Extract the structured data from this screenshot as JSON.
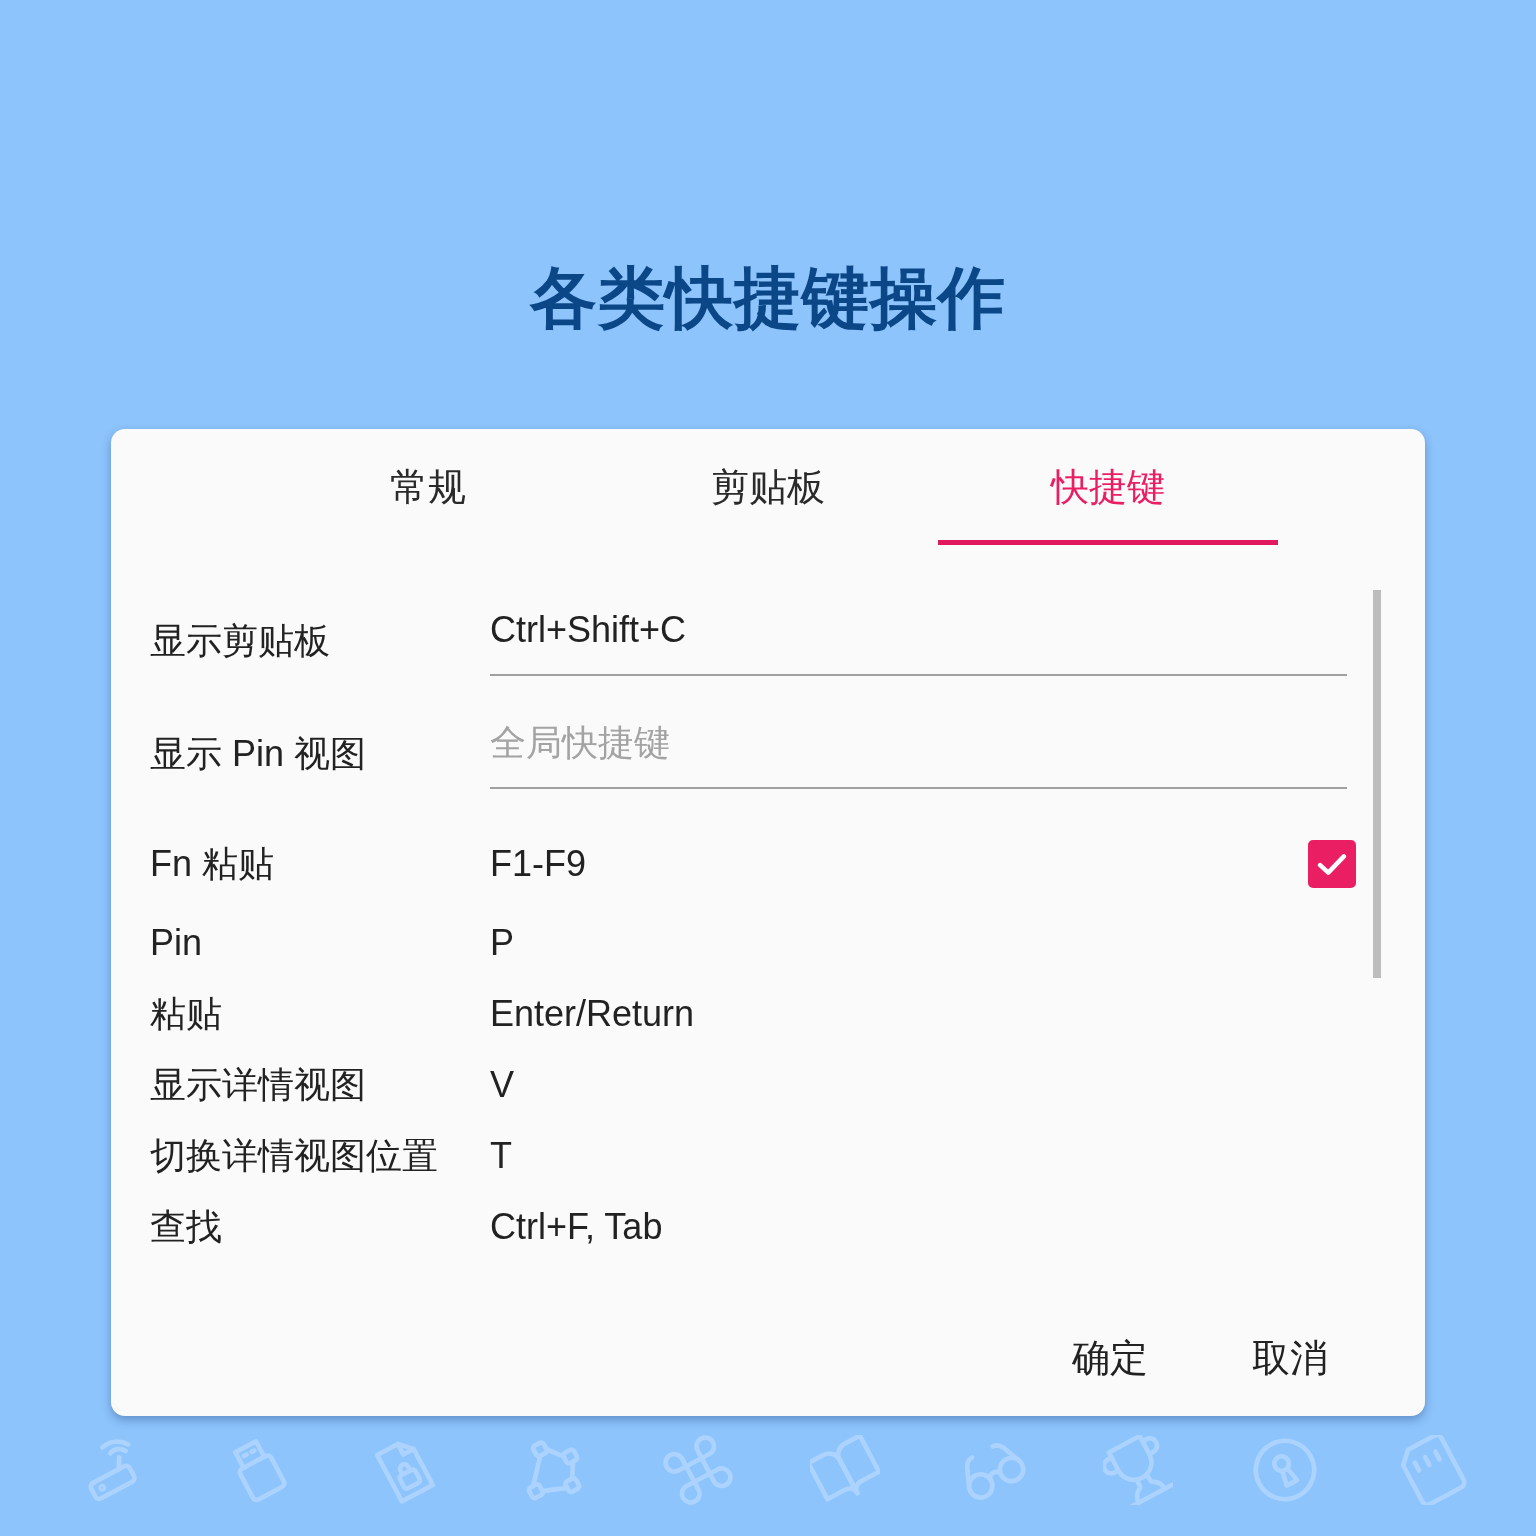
{
  "title": "各类快捷键操作",
  "dialog": {
    "tabs": [
      {
        "label": "常规",
        "selected": false
      },
      {
        "label": "剪贴板",
        "selected": false
      },
      {
        "label": "快捷键",
        "selected": true
      }
    ],
    "settings": [
      {
        "kind": "input",
        "label": "显示剪贴板",
        "value": "Ctrl+Shift+C"
      },
      {
        "kind": "input",
        "label": "显示 Pin 视图",
        "placeholder": "全局快捷键"
      },
      {
        "kind": "checkbox",
        "label": "Fn 粘贴",
        "value": "F1-F9",
        "checked": true
      },
      {
        "kind": "text",
        "label": "Pin",
        "value": "P"
      },
      {
        "kind": "text",
        "label": "粘贴",
        "value": "Enter/Return"
      },
      {
        "kind": "text",
        "label": "显示详情视图",
        "value": "V"
      },
      {
        "kind": "text",
        "label": "切换详情视图位置",
        "value": "T"
      },
      {
        "kind": "text",
        "label": "查找",
        "value": "Ctrl+F, Tab"
      }
    ],
    "buttons": [
      "确定",
      "取消"
    ]
  }
}
